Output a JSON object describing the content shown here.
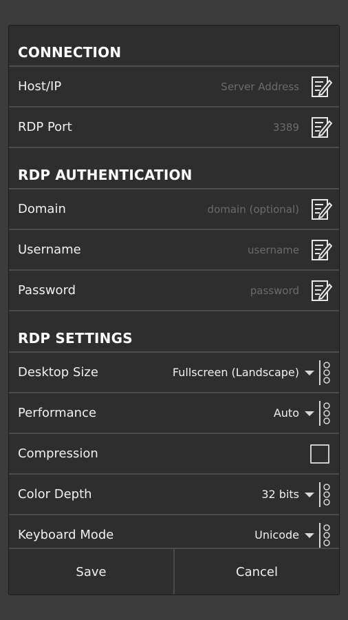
{
  "sections": {
    "connection": {
      "title": "CONNECTION",
      "host": {
        "label": "Host/IP",
        "placeholder": "Server Address"
      },
      "port": {
        "label": "RDP Port",
        "placeholder": "3389"
      }
    },
    "authentication": {
      "title": "RDP AUTHENTICATION",
      "domain": {
        "label": "Domain",
        "placeholder": "domain (optional)"
      },
      "username": {
        "label": "Username",
        "placeholder": "username"
      },
      "password": {
        "label": "Password",
        "placeholder": "password"
      }
    },
    "settings": {
      "title": "RDP SETTINGS",
      "desktop_size": {
        "label": "Desktop Size",
        "value": "Fullscreen (Landscape)"
      },
      "performance": {
        "label": "Performance",
        "value": "Auto"
      },
      "compression": {
        "label": "Compression",
        "checked": false
      },
      "color_depth": {
        "label": "Color Depth",
        "value": "32 bits"
      },
      "keyboard_mode": {
        "label": "Keyboard Mode",
        "value": "Unicode"
      }
    }
  },
  "buttons": {
    "save": "Save",
    "cancel": "Cancel"
  },
  "icons": {
    "edit": "edit-pencil-icon",
    "dropdown": "dropdown-arrow-icon",
    "spinner": "spinner-dots-icon"
  },
  "colors": {
    "background": "#3b3b3b",
    "panel": "#2e2e2e",
    "divider": "#4a4a4a",
    "placeholder": "#6b6b6b"
  }
}
